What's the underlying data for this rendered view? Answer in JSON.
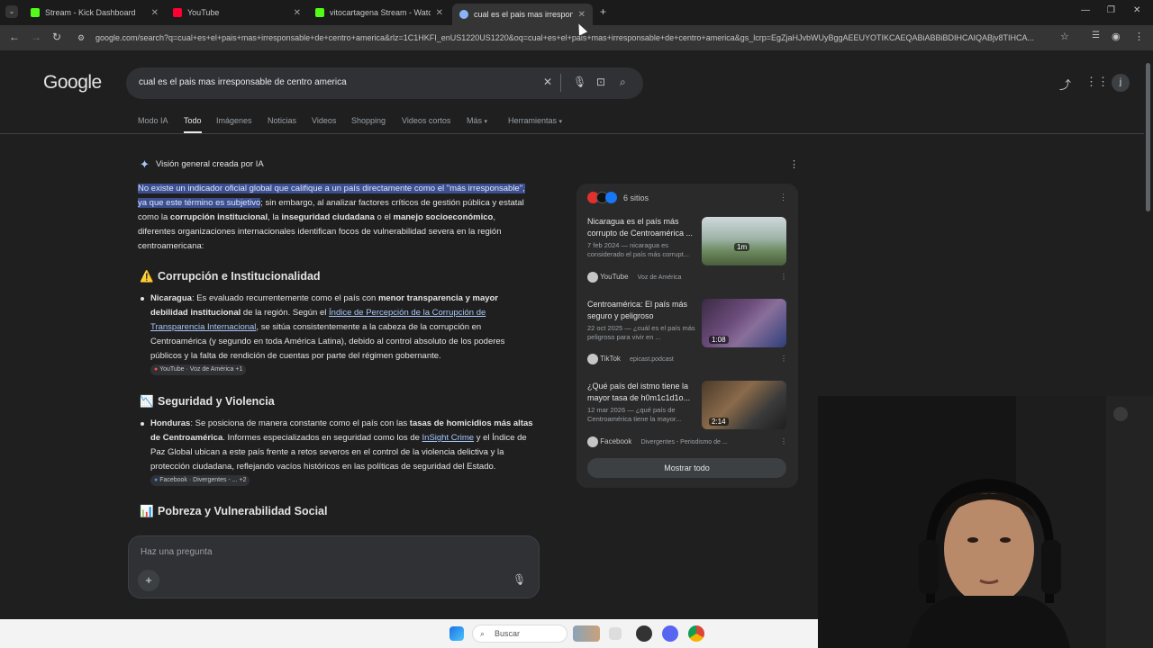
{
  "browser": {
    "tabs": [
      {
        "label": "Stream - Kick Dashboard",
        "icon": "kick-icon",
        "color": "#53fc18"
      },
      {
        "label": "YouTube",
        "icon": "youtube-icon",
        "color": "#ff0033"
      },
      {
        "label": "vitocartagena Stream - Watch L",
        "icon": "kick-icon",
        "color": "#53fc18"
      },
      {
        "label": "cual es el pais mas irresponsabl",
        "icon": "google-icon",
        "color": "#8ab4f8"
      }
    ],
    "url": "google.com/search?q=cual+es+el+pais+mas+irresponsable+de+centro+america&rlz=1C1HKFI_enUS1220US1220&oq=cual+es+el+pais+mas+irresponsable+de+centro+america&gs_lcrp=EgZjaHJvbWUyBggAEEUYOTIKCAEQABiABBiBDIHCAIQABjv8TIHCA..."
  },
  "search": {
    "logo": "Google",
    "query": "cual es el pais mas irresponsable de centro america"
  },
  "filters": [
    "Modo IA",
    "Todo",
    "Imágenes",
    "Noticias",
    "Videos",
    "Shopping",
    "Videos cortos",
    "Más",
    "Herramientas"
  ],
  "ai": {
    "header": "Visión general creada por IA",
    "intro_hl": "No existe un indicador oficial global que califique a un país directamente como el \"más irresponsable\", ya que este término es subjetivo",
    "intro_1": "; sin embargo, al analizar factores críticos de gestión pública y estatal como la ",
    "intro_b1": "corrupción institucional",
    "intro_2": ", la ",
    "intro_b2": "inseguridad ciudadana",
    "intro_3": " o el ",
    "intro_b3": "manejo socioeconómico",
    "intro_4": ", diferentes organizaciones internacionales identifican focos de vulnerabilidad severa en la región centroamericana:",
    "sections": [
      {
        "icon": "⚠️",
        "title": "Corrupción e Institucionalidad",
        "b_country": "Nicaragua",
        "t1": ": Es evaluado recurrentemente como el país con ",
        "b1": "menor transparencia y mayor debilidad institucional",
        "t2": " de la región. Según el ",
        "link": "Índice de Percepción de la Corrupción de Transparencia Internacional",
        "t3": ", se sitúa consistentemente a la cabeza de la corrupción en Centroamérica (y segundo en toda América Latina), debido al control absoluto de los poderes públicos y la falta de rendición de cuentas por parte del régimen gobernante.",
        "chip": "YouTube · Voz de América +1"
      },
      {
        "icon": "📉",
        "title": "Seguridad y Violencia",
        "b_country": "Honduras",
        "t1": ": Se posiciona de manera constante como el país con las ",
        "b1": "tasas de homicidios más altas de Centroamérica",
        "t2": ". Informes especializados en seguridad como los de ",
        "link": "InSight Crime",
        "t3": " y el Índice de Paz Global ubican a este país frente a retos severos en el control de la violencia delictiva y la protección ciudadana, reflejando vacíos históricos en las políticas de seguridad del Estado.",
        "chip": "Facebook · Divergentes - ... +2"
      },
      {
        "icon": "📊",
        "title": "Pobreza y Vulnerabilidad Social"
      }
    ]
  },
  "sources": {
    "count": "6 sitios",
    "items": [
      {
        "title": "Nicaragua es el país más corrupto de Centroamérica ...",
        "snippet": "7 feb 2024 — nicaragua es considerado el país más corrupt...",
        "platform": "YouTube",
        "publisher": "Voz de América",
        "duration": "1m"
      },
      {
        "title": "Centroamérica: El país más seguro y peligroso",
        "snippet": "22 oct 2025 — ¿cuál es el país más peligroso para vivir en ...",
        "platform": "TikTok",
        "publisher": "epicast.podcast",
        "duration": "1:08"
      },
      {
        "title": "¿Qué país del istmo tiene la mayor tasa de h0m1c1d1o...",
        "snippet": "12 mar 2026 — ¿qué país de Centroamérica tiene la mayor...",
        "platform": "Facebook",
        "publisher": "Divergentes - Periodismo de ...",
        "duration": "2:14"
      }
    ],
    "show_all": "Mostrar todo"
  },
  "ask": {
    "placeholder": "Haz una pregunta"
  },
  "taskbar": {
    "search": "Buscar"
  },
  "colors": {
    "highlight": "#3c4f8e",
    "link": "#a8c7fa",
    "page_bg": "#1f1f1f"
  }
}
